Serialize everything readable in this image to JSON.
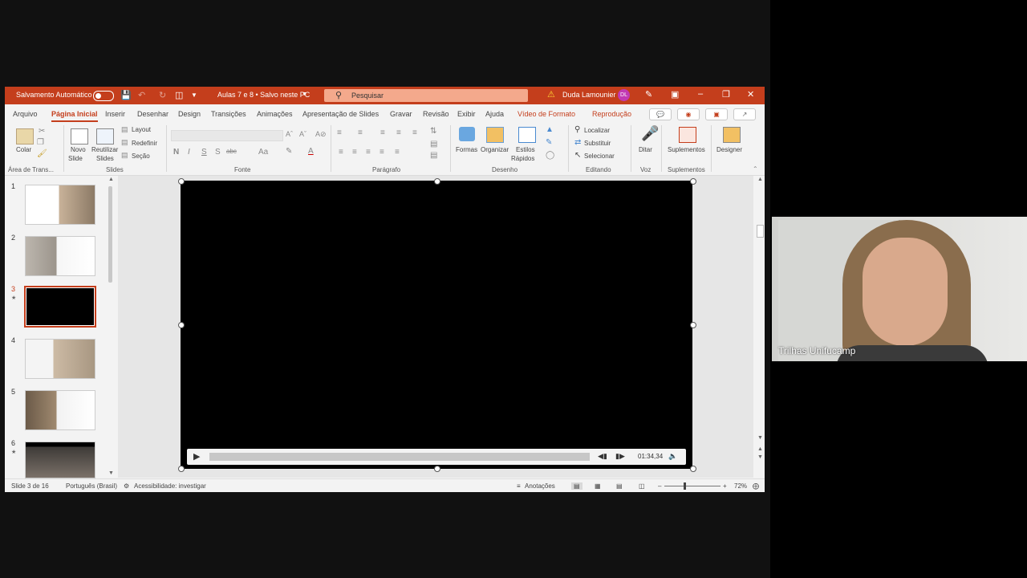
{
  "titlebar": {
    "autosave_label": "Salvamento Automático",
    "doc_title": "Aulas 7 e 8 • Salvo neste PC",
    "search_placeholder": "Pesquisar",
    "user_name": "Duda Lamounier",
    "user_initials": "DL"
  },
  "tabs": [
    "Arquivo",
    "Página Inicial",
    "Inserir",
    "Desenhar",
    "Design",
    "Transições",
    "Animações",
    "Apresentação de Slides",
    "Gravar",
    "Revisão",
    "Exibir",
    "Ajuda"
  ],
  "active_tab": "Página Inicial",
  "context_tabs": [
    "Vídeo de Formato",
    "Reprodução"
  ],
  "ribbon": {
    "clipboard": {
      "paste": "Colar",
      "group": "Área de Trans..."
    },
    "slides": {
      "new_slide": "Novo",
      "new_slide2": "Slide",
      "reuse": "Reutilizar",
      "reuse2": "Slides",
      "layout": "Layout",
      "reset": "Redefinir",
      "section": "Seção",
      "group": "Slides"
    },
    "font": {
      "group": "Fonte",
      "buttons": [
        "N",
        "I",
        "S",
        "S",
        "abc",
        "Aa"
      ]
    },
    "paragraph": {
      "group": "Parágrafo"
    },
    "drawing": {
      "shapes": "Formas",
      "arrange": "Organizar",
      "quick_styles": "Estilos",
      "quick_styles2": "Rápidos",
      "group": "Desenho"
    },
    "editing": {
      "find": "Localizar",
      "replace": "Substituir",
      "select": "Selecionar",
      "group": "Editando"
    },
    "voice": {
      "dictate": "Ditar",
      "group": "Voz"
    },
    "addins": {
      "addins": "Suplementos",
      "group": "Suplementos"
    },
    "designer": {
      "designer": "Designer"
    }
  },
  "slides": [
    {
      "number": "1",
      "star": false
    },
    {
      "number": "2",
      "star": false
    },
    {
      "number": "3",
      "star": true
    },
    {
      "number": "4",
      "star": false
    },
    {
      "number": "5",
      "star": false
    },
    {
      "number": "6",
      "star": true
    }
  ],
  "selected_slide": "3",
  "player": {
    "time": "01:34,34",
    "progress": 0
  },
  "status": {
    "slide_count": "Slide 3 de 16",
    "language": "Português (Brasil)",
    "accessibility": "Acessibilidade: investigar",
    "notes": "Anotações",
    "zoom": "72%"
  },
  "webcam": {
    "name": "Trilhas Unifucamp"
  },
  "colors": {
    "accent": "#c43e1c",
    "search_bg": "#f4a98c",
    "avatar": "#c239b3"
  }
}
